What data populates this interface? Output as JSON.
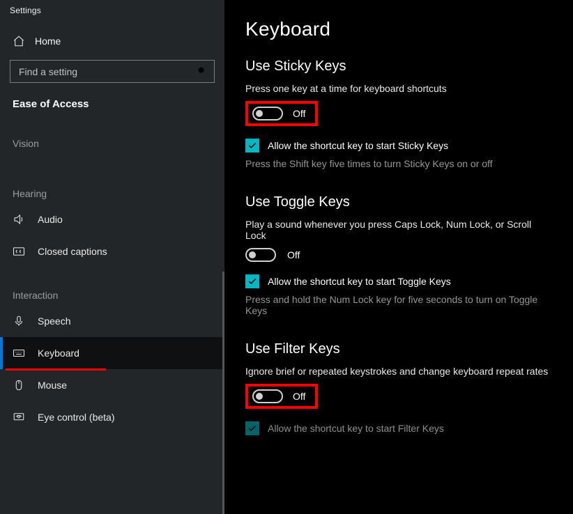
{
  "window": {
    "title": "Settings"
  },
  "sidebar": {
    "home": "Home",
    "search_placeholder": "Find a setting",
    "category": "Ease of Access",
    "groups": {
      "vision_label": "Vision",
      "hearing_label": "Hearing",
      "interaction_label": "Interaction"
    },
    "items": {
      "audio": "Audio",
      "closed_captions": "Closed captions",
      "speech": "Speech",
      "keyboard": "Keyboard",
      "mouse": "Mouse",
      "eye_control": "Eye control (beta)"
    }
  },
  "page": {
    "title": "Keyboard",
    "sticky": {
      "heading": "Use Sticky Keys",
      "desc": "Press one key at a time for keyboard shortcuts",
      "toggle_state": "Off",
      "checkbox_label": "Allow the shortcut key to start Sticky Keys",
      "hint": "Press the Shift key five times to turn Sticky Keys on or off"
    },
    "togglekeys": {
      "heading": "Use Toggle Keys",
      "desc": "Play a sound whenever you press Caps Lock, Num Lock, or Scroll Lock",
      "toggle_state": "Off",
      "checkbox_label": "Allow the shortcut key to start Toggle Keys",
      "hint": "Press and hold the Num Lock key for five seconds to turn on Toggle Keys"
    },
    "filter": {
      "heading": "Use Filter Keys",
      "desc": "Ignore brief or repeated keystrokes and change keyboard repeat rates",
      "toggle_state": "Off",
      "checkbox_label": "Allow the shortcut key to start Filter Keys"
    }
  }
}
